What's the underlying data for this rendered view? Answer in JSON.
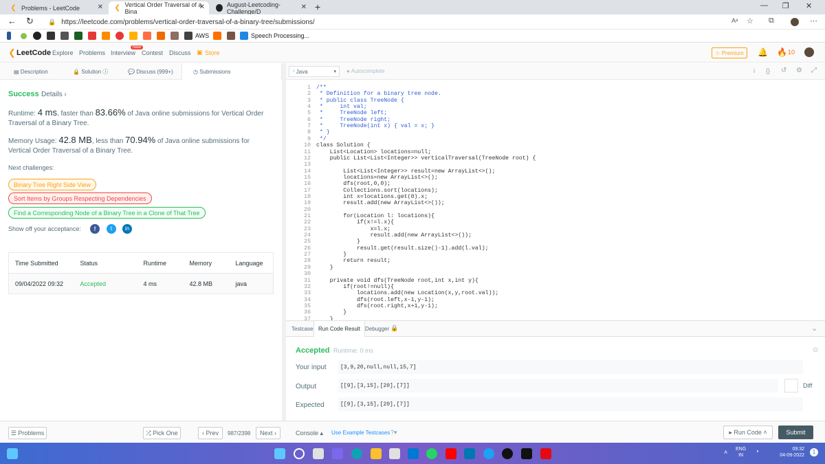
{
  "browser": {
    "tabs": [
      {
        "title": "Problems - LeetCode",
        "active": false
      },
      {
        "title": "Vertical Order Traversal of a Bina",
        "active": true
      },
      {
        "title": "August-Leetcoding-Challenge/D",
        "active": false
      }
    ],
    "url": "https://leetcode.com/problems/vertical-order-traversal-of-a-binary-tree/submissions/",
    "bookmarks": {
      "aws": "AWS",
      "speech": "Speech Processing..."
    }
  },
  "nav": {
    "brand": "LeetCode",
    "items": [
      "Explore",
      "Problems",
      "Interview",
      "Contest",
      "Discuss"
    ],
    "new_badge": "New",
    "store": "Store",
    "premium": "Premium",
    "streak": "10"
  },
  "left_tabs": {
    "description": "Description",
    "solution": "Solution",
    "discuss": "Discuss (999+)",
    "submissions": "Submissions"
  },
  "result": {
    "status": "Success",
    "details": "Details",
    "runtime_prefix": "Runtime: ",
    "runtime_value": "4 ms",
    "runtime_mid": ", faster than ",
    "runtime_pct": "83.66%",
    "runtime_suffix": " of Java online submissions for Vertical Order Traversal of a Binary Tree.",
    "memory_prefix": "Memory Usage: ",
    "memory_value": "42.8 MB",
    "memory_mid": ", less than ",
    "memory_pct": "70.94%",
    "memory_suffix": " of Java online submissions for Vertical Order Traversal of a Binary Tree.",
    "next_challenges": "Next challenges:",
    "challenges": [
      "Binary Tree Right Side View",
      "Sort Items by Groups Respecting Dependencies",
      "Find a Corresponding Node of a Binary Tree in a Clone of That Tree"
    ],
    "share": "Show off your acceptance:"
  },
  "submissions": {
    "headers": [
      "Time Submitted",
      "Status",
      "Runtime",
      "Memory",
      "Language"
    ],
    "rows": [
      [
        "09/04/2022 09:32",
        "Accepted",
        "4 ms",
        "42.8 MB",
        "java"
      ]
    ]
  },
  "editor": {
    "language": "Java",
    "autocomplete": "Autocomplete",
    "lines": [
      [
        "1",
        "/**"
      ],
      [
        "2",
        " * Definition for a binary tree node."
      ],
      [
        "3",
        " * public class TreeNode {"
      ],
      [
        "4",
        " *     int val;"
      ],
      [
        "5",
        " *     TreeNode left;"
      ],
      [
        "6",
        " *     TreeNode right;"
      ],
      [
        "7",
        " *     TreeNode(int x) { val = x; }"
      ],
      [
        "8",
        " * }"
      ],
      [
        "9",
        " */"
      ],
      [
        "10",
        "class Solution {"
      ],
      [
        "11",
        "    List<Location> locations=null;"
      ],
      [
        "12",
        "    public List<List<Integer>> verticalTraversal(TreeNode root) {"
      ],
      [
        "13",
        ""
      ],
      [
        "14",
        "        List<List<Integer>> result=new ArrayList<>();"
      ],
      [
        "15",
        "        locations=new ArrayList<>();"
      ],
      [
        "16",
        "        dfs(root,0,0);"
      ],
      [
        "17",
        "        Collections.sort(locations);"
      ],
      [
        "18",
        "        int x=locations.get(0).x;"
      ],
      [
        "19",
        "        result.add(new ArrayList<>());"
      ],
      [
        "20",
        ""
      ],
      [
        "21",
        "        for(Location l: locations){"
      ],
      [
        "22",
        "            if(x!=l.x){"
      ],
      [
        "23",
        "                x=l.x;"
      ],
      [
        "24",
        "                result.add(new ArrayList<>());"
      ],
      [
        "25",
        "            }"
      ],
      [
        "26",
        "            result.get(result.size()-1).add(l.val);"
      ],
      [
        "27",
        "        }"
      ],
      [
        "28",
        "        return result;"
      ],
      [
        "29",
        "    }"
      ],
      [
        "30",
        ""
      ],
      [
        "31",
        "    private void dfs(TreeNode root,int x,int y){"
      ],
      [
        "32",
        "        if(root!=null){"
      ],
      [
        "33",
        "            locations.add(new Location(x,y,root.val));"
      ],
      [
        "34",
        "            dfs(root.left,x-1,y-1);"
      ],
      [
        "35",
        "            dfs(root.right,x+1,y-1);"
      ],
      [
        "36",
        "        }"
      ],
      [
        "37",
        "    }"
      ]
    ]
  },
  "console": {
    "tabs": [
      "Testcase",
      "Run Code Result",
      "Debugger"
    ],
    "accepted": "Accepted",
    "runtime": "Runtime: 0 ms",
    "your_input_label": "Your input",
    "your_input": "[3,9,20,null,null,15,7]",
    "output_label": "Output",
    "output": "[[9],[3,15],[20],[7]]",
    "diff": "Diff",
    "expected_label": "Expected",
    "expected": "[[9],[3,15],[20],[7]]"
  },
  "bottom": {
    "problems": "Problems",
    "pick_one": "Pick One",
    "prev": "Prev",
    "page": "987/2398",
    "next": "Next",
    "console": "Console",
    "use_example": "Use Example Testcases",
    "run_code": "Run Code",
    "submit": "Submit"
  },
  "taskbar": {
    "lang": "ENG",
    "region": "IN",
    "time": "09:32",
    "date": "04-09-2022"
  },
  "colors": {
    "accent": "#2cbb5d",
    "premium": "#ffa116",
    "brand": "#f89f1b",
    "blue": "#1890ff"
  }
}
